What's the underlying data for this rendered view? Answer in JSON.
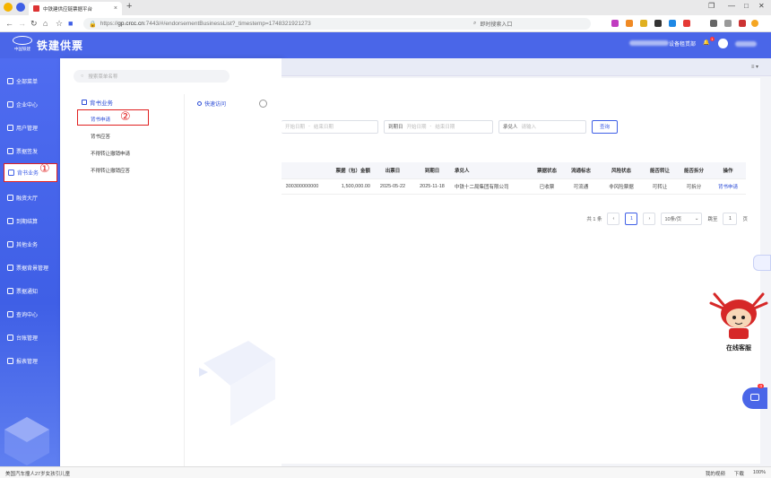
{
  "browser": {
    "tab_title": "中铁建供应链票据平台",
    "url_prefix": "https://",
    "url_host": "gp.crcc.cn",
    "url_rest": ":7443/#/endorsementBusinessList?_timestemp=1748321921273",
    "search_placeholder": "即时搜索入口"
  },
  "header": {
    "brand": "铁建供票",
    "logo_sub": "中国铁建",
    "user_suffix": "设备租赁部",
    "bell_badge": "1"
  },
  "sidebar": {
    "items": [
      {
        "label": "全部菜单"
      },
      {
        "label": "企业中心"
      },
      {
        "label": "用户管理"
      },
      {
        "label": "票据签发"
      },
      {
        "label": "背书业务"
      },
      {
        "label": "融资大厅"
      },
      {
        "label": "到期结算"
      },
      {
        "label": "其他业务"
      },
      {
        "label": "票据背景管理"
      },
      {
        "label": "票据通知"
      },
      {
        "label": "查询中心"
      },
      {
        "label": "台账管理"
      },
      {
        "label": "报表管理"
      }
    ],
    "marker": "①"
  },
  "flyout": {
    "search_placeholder": "搜索菜单名称",
    "section_title": "背书业务",
    "links": [
      "背书申请",
      "背书应答",
      "不得转让撤销申请",
      "不得转让撤销应答"
    ],
    "marker": "②",
    "quick_access": "快速访问"
  },
  "filters": {
    "date1_start": "开始日期",
    "date1_end": "结束日期",
    "due_label": "到期日",
    "due_start": "开始日期",
    "due_end": "结束日期",
    "acceptor_label": "承兑人",
    "acceptor_placeholder": "请输入",
    "query_button": "查询"
  },
  "table": {
    "headers": [
      "",
      "票据（包）金额",
      "出票日",
      "到期日",
      "承兑人",
      "票据状态",
      "流通标志",
      "风险状态",
      "能否转让",
      "能否拆分",
      "操作"
    ],
    "rows": [
      [
        "300300000000",
        "1,500,000.00",
        "2025-05-22",
        "2025-11-18",
        "中铁十二局集团有限公司",
        "已收票",
        "可流通",
        "非风险票据",
        "可转让",
        "可拆分",
        "背书申请"
      ]
    ]
  },
  "pager": {
    "total": "共 1 条",
    "current_page": "1",
    "page_size": "10条/页",
    "goto_label": "跳至",
    "goto_value": "1",
    "goto_suffix": "页"
  },
  "mascot": {
    "label": "在线客服",
    "chat_badge": "0"
  },
  "statusbar": {
    "news": "美国汽车撞人27岁女孩引儿童",
    "right": [
      "我的视频",
      "下载",
      "100%"
    ]
  }
}
